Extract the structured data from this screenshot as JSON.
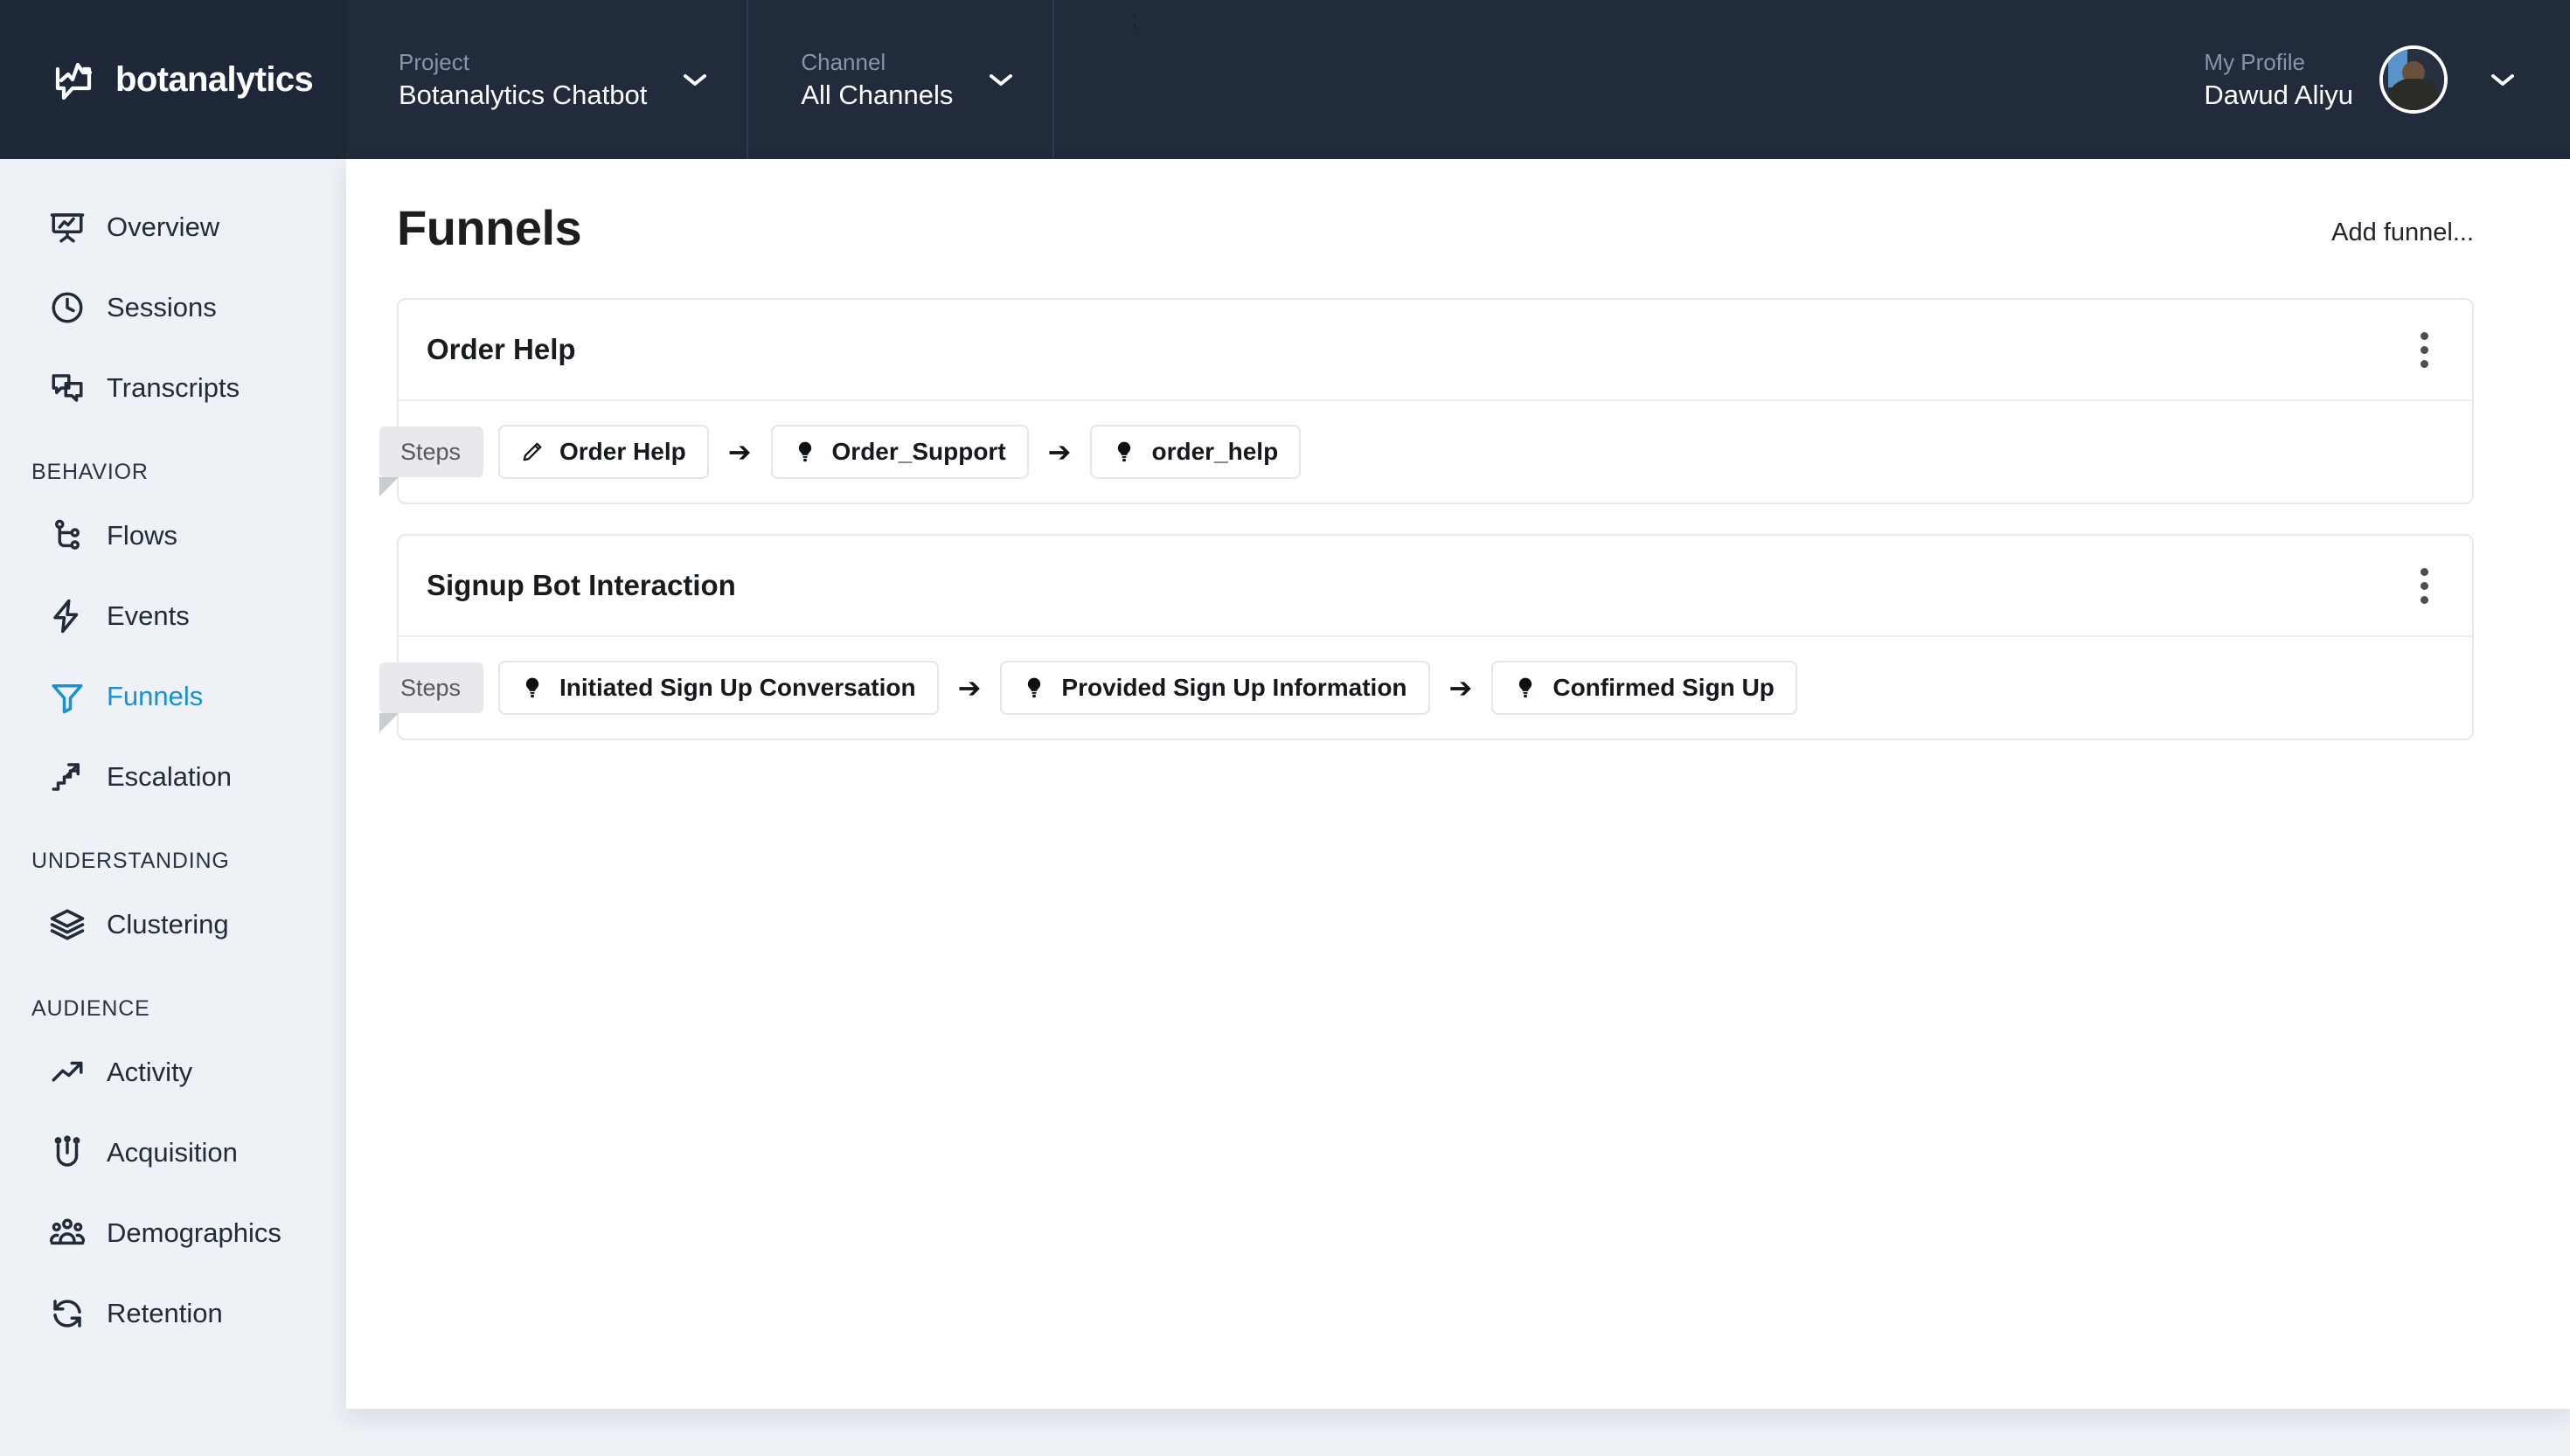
{
  "brand": {
    "name": "botanalytics",
    "logo_icon": "botanalytics-speech-chart-logo"
  },
  "topbar": {
    "marker": ";",
    "project": {
      "label": "Project",
      "value": "Botanalytics Chatbot",
      "chevron_icon": "chevron-down-icon"
    },
    "channel": {
      "label": "Channel",
      "value": "All Channels",
      "chevron_icon": "chevron-down-icon"
    },
    "profile": {
      "label": "My Profile",
      "value": "Dawud Aliyu",
      "avatar_icon": "user-avatar",
      "chevron_icon": "chevron-down-icon"
    }
  },
  "sidebar": {
    "items": [
      {
        "label": "Overview",
        "icon": "presentation-chart-icon",
        "active": false
      },
      {
        "label": "Sessions",
        "icon": "clock-icon",
        "active": false
      },
      {
        "label": "Transcripts",
        "icon": "chat-bubbles-icon",
        "active": false
      }
    ],
    "groups": [
      {
        "title": "BEHAVIOR",
        "items": [
          {
            "label": "Flows",
            "icon": "branch-nodes-icon",
            "active": false
          },
          {
            "label": "Events",
            "icon": "lightning-bolt-icon",
            "active": false
          },
          {
            "label": "Funnels",
            "icon": "funnel-icon",
            "active": true
          },
          {
            "label": "Escalation",
            "icon": "stairs-arrow-icon",
            "active": false
          }
        ]
      },
      {
        "title": "UNDERSTANDING",
        "items": [
          {
            "label": "Clustering",
            "icon": "layers-icon",
            "active": false
          }
        ]
      },
      {
        "title": "AUDIENCE",
        "items": [
          {
            "label": "Activity",
            "icon": "trend-arrow-icon",
            "active": false
          },
          {
            "label": "Acquisition",
            "icon": "magnet-people-icon",
            "active": false
          },
          {
            "label": "Demographics",
            "icon": "people-group-icon",
            "active": false
          },
          {
            "label": "Retention",
            "icon": "refresh-cycle-icon",
            "active": false
          }
        ]
      }
    ]
  },
  "main": {
    "title": "Funnels",
    "add_funnel_label": "Add funnel...",
    "steps_tag_label": "Steps",
    "menu_icon": "kebab-menu-icon",
    "arrow_glyph": "➔",
    "funnels": [
      {
        "name": "Order Help",
        "steps": [
          {
            "label": "Order Help",
            "icon": "pencil-icon"
          },
          {
            "label": "Order_Support",
            "icon": "lightbulb-icon"
          },
          {
            "label": "order_help",
            "icon": "lightbulb-icon"
          }
        ]
      },
      {
        "name": "Signup Bot Interaction",
        "steps": [
          {
            "label": "Initiated Sign Up Conversation",
            "icon": "lightbulb-icon"
          },
          {
            "label": "Provided Sign Up Information",
            "icon": "lightbulb-icon"
          },
          {
            "label": "Confirmed Sign Up",
            "icon": "lightbulb-icon"
          }
        ]
      }
    ]
  },
  "colors": {
    "header_bg": "#212b3c",
    "sidebar_bg": "#eef1f6",
    "accent": "#1a8fd4",
    "text_dark": "#222b3a"
  }
}
